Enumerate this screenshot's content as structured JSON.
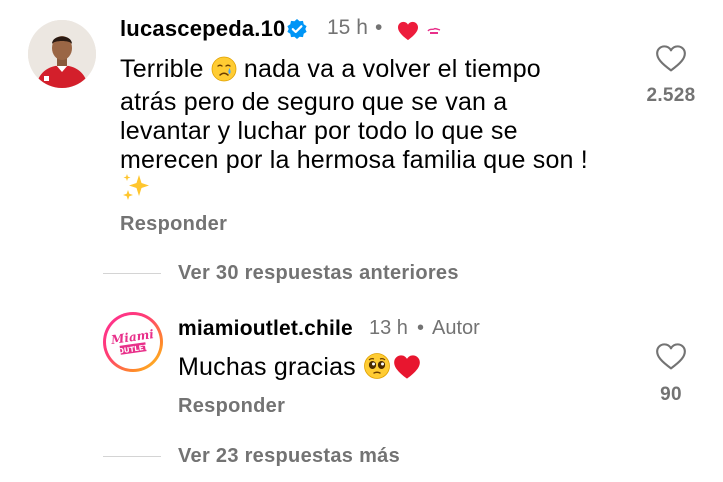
{
  "comment": {
    "username": "lucascepeda.10",
    "time": "15 h",
    "separator": "•",
    "text_line1": "Terrible ",
    "text_line1b": " nada va a volver el tiempo",
    "text_line2": "atrás pero de seguro que se van a",
    "text_line3": "levantar y luchar por todo lo que se",
    "text_line4": "merecen por la hermosa familia que son !",
    "reply_label": "Responder",
    "like_count": "2.528",
    "icons": [
      "verified-icon",
      "liked-by-author-heart-icon",
      "crying-face-emoji",
      "sparkles-emoji",
      "heart-outline-icon"
    ]
  },
  "thread": {
    "previous_label": "Ver 30 respuestas anteriores",
    "more_label": "Ver 23 respuestas más"
  },
  "reply": {
    "username": "miamioutlet.chile",
    "time": "13 h",
    "separator": "•",
    "author_label": "Autor",
    "text": "Muchas gracias ",
    "reply_label": "Responder",
    "like_count": "90",
    "avatar_logo_line1": "Miami",
    "avatar_logo_line2": "OUTLET",
    "colors": {
      "ring_start": "#ff2d95",
      "ring_end": "#ffd21f",
      "logo_pink": "#e8308a"
    }
  },
  "colors": {
    "secondary_text": "#737373",
    "verified_blue": "#0095f6",
    "heart_red": "#ed1c3c"
  }
}
